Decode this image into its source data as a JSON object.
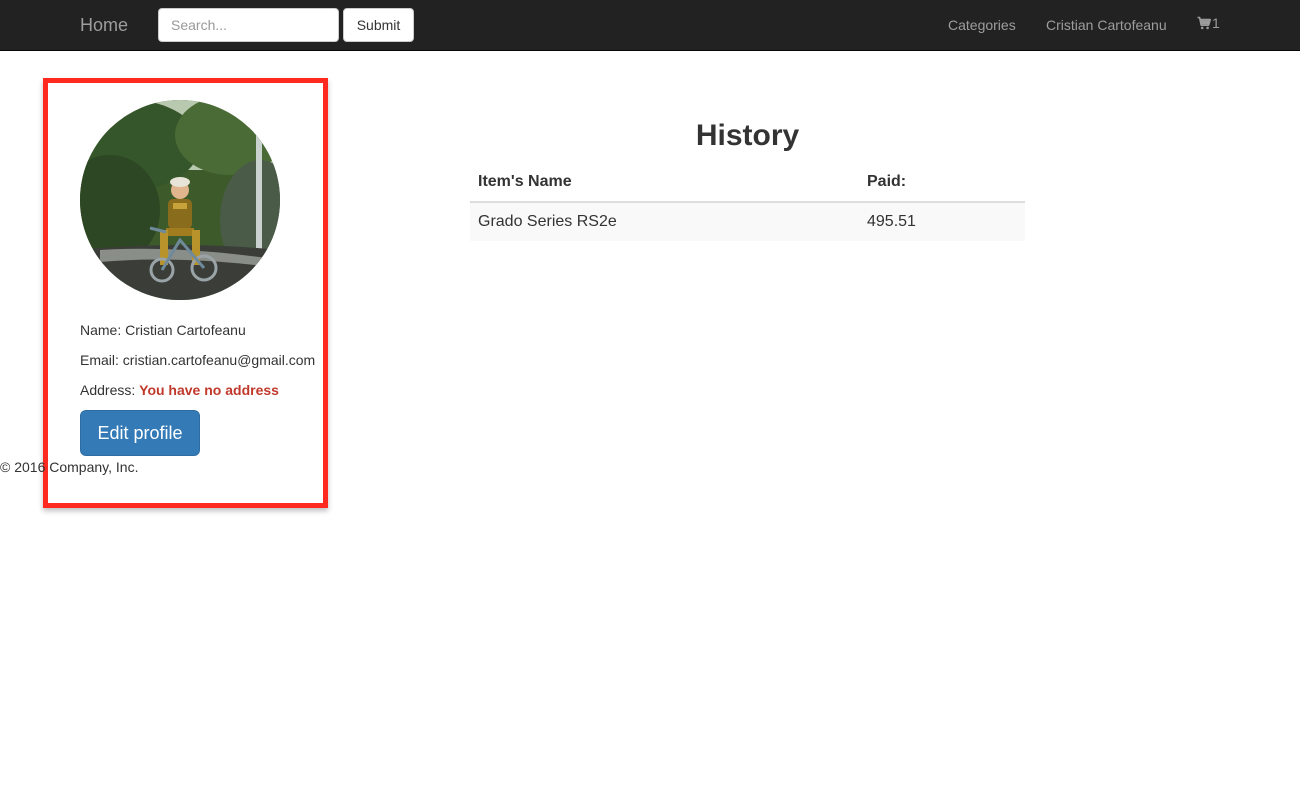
{
  "navbar": {
    "brand": "Home",
    "search": {
      "placeholder": "Search..."
    },
    "submit_label": "Submit",
    "links": {
      "categories": "Categories",
      "user": "Cristian Cartofeanu"
    },
    "cart": {
      "icon": "cart-icon",
      "count": "1"
    }
  },
  "profile": {
    "avatar_icon": "avatar-photo",
    "name_label": "Name: ",
    "name_value": "Cristian Cartofeanu",
    "email_label": "Email: ",
    "email_value": "cristian.cartofeanu@gmail.com",
    "address_label": "Address: ",
    "address_value": "You have no address",
    "edit_label": "Edit profile"
  },
  "history": {
    "title": "History",
    "columns": [
      "Item's Name",
      "Paid:"
    ],
    "rows": [
      {
        "name": "Grado Series RS2e",
        "paid": "495.51"
      }
    ]
  },
  "footer": {
    "text": "© 2016 Company, Inc."
  },
  "colors": {
    "navbar_bg": "#222222",
    "nav_text": "#9d9d9d",
    "primary": "#337ab7",
    "highlight_border": "#ff2a1f",
    "no_address": "#c0392b"
  }
}
